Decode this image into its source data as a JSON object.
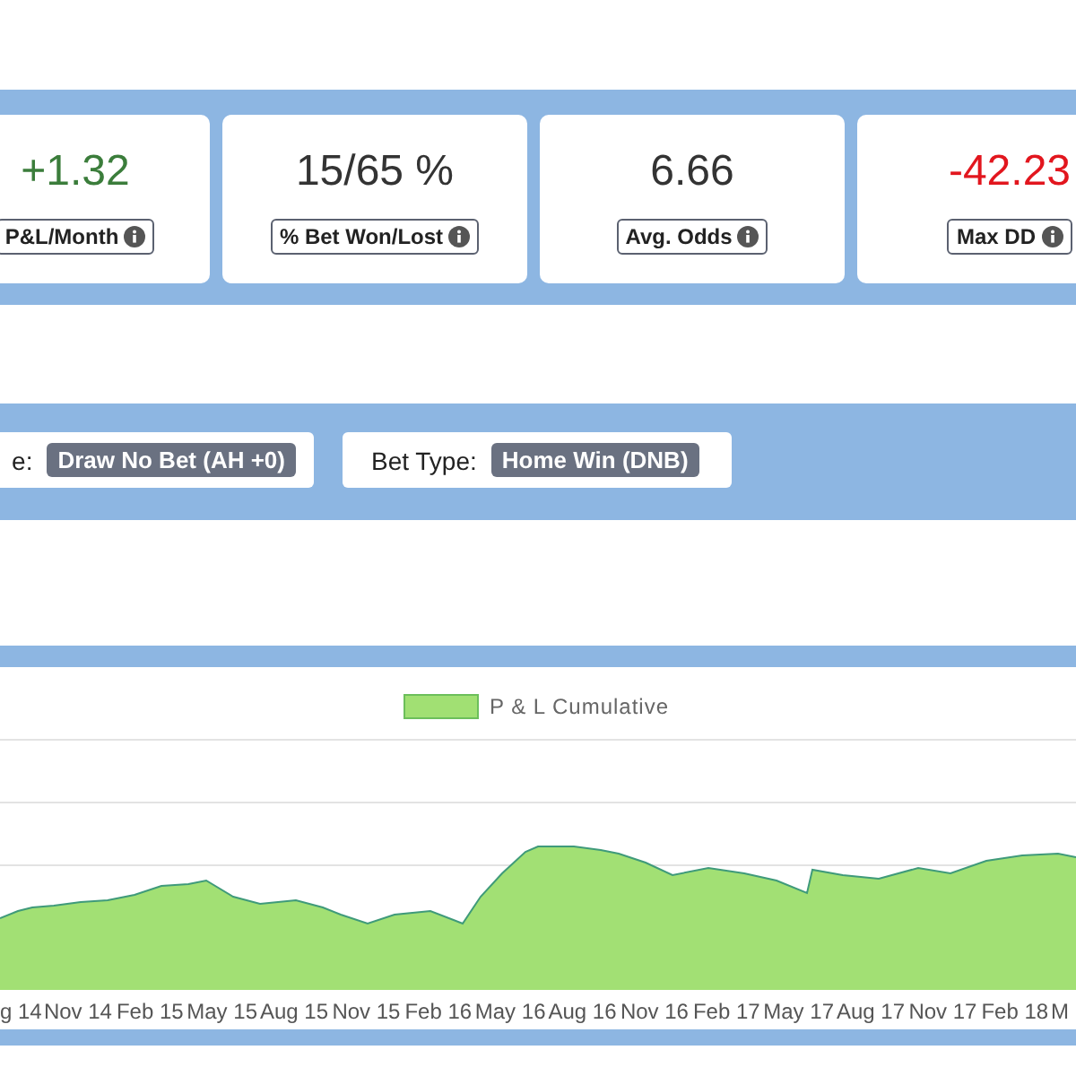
{
  "stats": [
    {
      "value": "+1.32",
      "label": "P&L/Month",
      "color": "#3b7d3b"
    },
    {
      "value": "15/65 %",
      "label": "% Bet Won/Lost",
      "color": "#333333"
    },
    {
      "value": "6.66",
      "label": "Avg. Odds",
      "color": "#333333"
    },
    {
      "value": "-42.23",
      "label": "Max DD",
      "color": "#e2161e"
    }
  ],
  "filters": [
    {
      "label": "e:",
      "value": "Draw No Bet (AH +0)"
    },
    {
      "label": "Bet Type:",
      "value": "Home Win (DNB)"
    }
  ],
  "chart": {
    "legend": "P & L Cumulative",
    "x_labels": [
      "g 14",
      "Nov 14",
      "Feb 15",
      "May 15",
      "Aug 15",
      "Nov 15",
      "Feb 16",
      "May 16",
      "Aug 16",
      "Nov 16",
      "Feb 17",
      "May 17",
      "Aug 17",
      "Nov 17",
      "Feb 18",
      "M"
    ]
  }
}
